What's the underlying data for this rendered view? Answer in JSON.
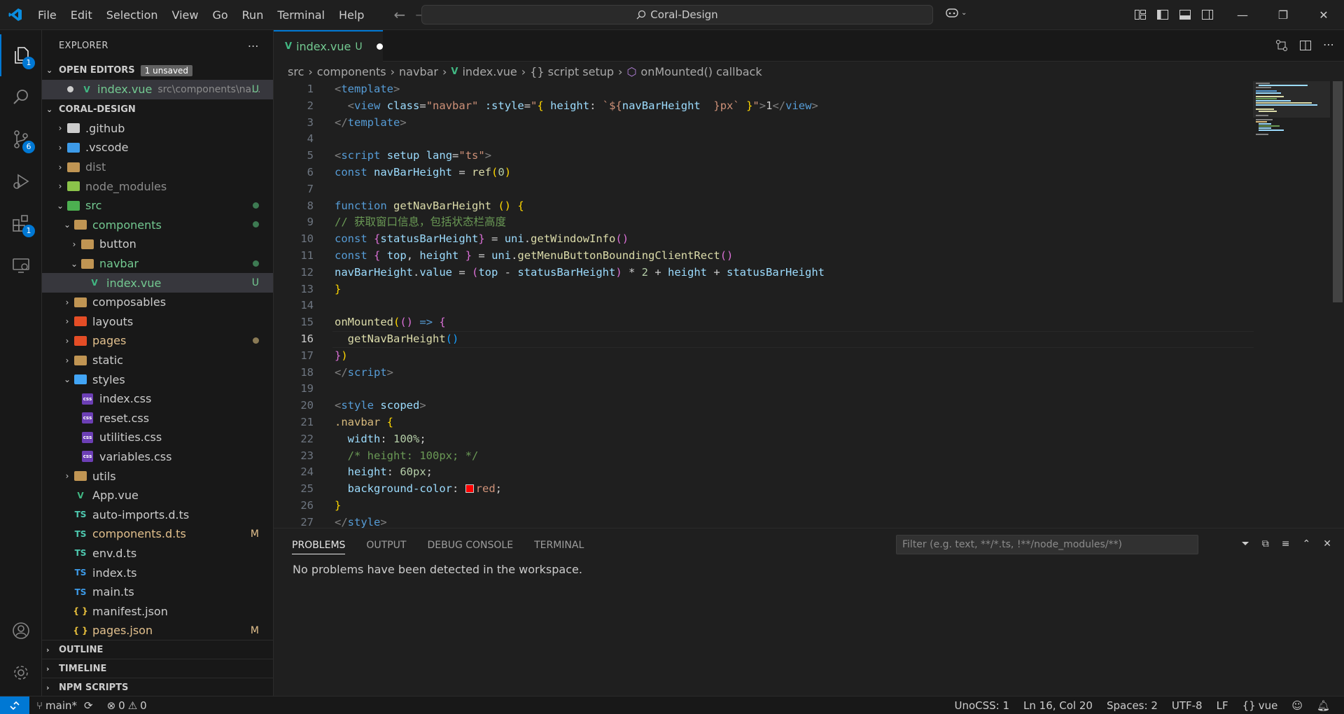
{
  "menu": [
    "File",
    "Edit",
    "Selection",
    "View",
    "Go",
    "Run",
    "Terminal",
    "Help"
  ],
  "search": {
    "label": "Coral-Design"
  },
  "activity": {
    "explorer_badge": "1",
    "scm_badge": "6",
    "extensions_badge": "1"
  },
  "explorer": {
    "title": "EXPLORER",
    "open_editors": {
      "title": "OPEN EDITORS",
      "badge": "1 unsaved",
      "file": "index.vue",
      "path": "src\\components\\na...",
      "status": "U"
    },
    "project": "CORAL-DESIGN",
    "tree": [
      {
        "name": ".github",
        "depth": 0,
        "twisty": "›",
        "icon": "folder-github",
        "color": "#cccccc"
      },
      {
        "name": ".vscode",
        "depth": 0,
        "twisty": "›",
        "icon": "folder-vscode",
        "color": "#cccccc"
      },
      {
        "name": "dist",
        "depth": 0,
        "twisty": "›",
        "icon": "folder-dist",
        "color": "#8c8c8c"
      },
      {
        "name": "node_modules",
        "depth": 0,
        "twisty": "›",
        "icon": "folder-node",
        "color": "#8c8c8c"
      },
      {
        "name": "src",
        "depth": 0,
        "twisty": "⌄",
        "icon": "folder-src",
        "color": "#73c991",
        "status": "dot-green"
      },
      {
        "name": "components",
        "depth": 1,
        "twisty": "⌄",
        "icon": "folder-components",
        "color": "#73c991",
        "status": "dot-green"
      },
      {
        "name": "button",
        "depth": 2,
        "twisty": "›",
        "icon": "folder",
        "color": "#cccccc"
      },
      {
        "name": "navbar",
        "depth": 2,
        "twisty": "⌄",
        "icon": "folder",
        "color": "#73c991",
        "status": "dot-green"
      },
      {
        "name": "index.vue",
        "depth": 3,
        "twisty": "",
        "icon": "vue",
        "color": "#73c991",
        "status": "U",
        "selected": true
      },
      {
        "name": "composables",
        "depth": 1,
        "twisty": "›",
        "icon": "folder",
        "color": "#cccccc"
      },
      {
        "name": "layouts",
        "depth": 1,
        "twisty": "›",
        "icon": "folder-layouts",
        "color": "#cccccc"
      },
      {
        "name": "pages",
        "depth": 1,
        "twisty": "›",
        "icon": "folder-pages",
        "color": "#e2c08d",
        "status": "dot-yellow"
      },
      {
        "name": "static",
        "depth": 1,
        "twisty": "›",
        "icon": "folder",
        "color": "#cccccc"
      },
      {
        "name": "styles",
        "depth": 1,
        "twisty": "⌄",
        "icon": "folder-styles",
        "color": "#cccccc"
      },
      {
        "name": "index.css",
        "depth": 2,
        "twisty": "",
        "icon": "css",
        "color": "#cccccc"
      },
      {
        "name": "reset.css",
        "depth": 2,
        "twisty": "",
        "icon": "css",
        "color": "#cccccc"
      },
      {
        "name": "utilities.css",
        "depth": 2,
        "twisty": "",
        "icon": "css",
        "color": "#cccccc"
      },
      {
        "name": "variables.css",
        "depth": 2,
        "twisty": "",
        "icon": "css",
        "color": "#cccccc"
      },
      {
        "name": "utils",
        "depth": 1,
        "twisty": "›",
        "icon": "folder-utils",
        "color": "#cccccc"
      },
      {
        "name": "App.vue",
        "depth": 1,
        "twisty": "",
        "icon": "vue",
        "color": "#cccccc"
      },
      {
        "name": "auto-imports.d.ts",
        "depth": 1,
        "twisty": "",
        "icon": "ts-green",
        "color": "#cccccc"
      },
      {
        "name": "components.d.ts",
        "depth": 1,
        "twisty": "",
        "icon": "ts-green",
        "color": "#e2c08d",
        "status": "M"
      },
      {
        "name": "env.d.ts",
        "depth": 1,
        "twisty": "",
        "icon": "ts-green",
        "color": "#cccccc"
      },
      {
        "name": "index.ts",
        "depth": 1,
        "twisty": "",
        "icon": "ts",
        "color": "#cccccc"
      },
      {
        "name": "main.ts",
        "depth": 1,
        "twisty": "",
        "icon": "ts",
        "color": "#cccccc"
      },
      {
        "name": "manifest.json",
        "depth": 1,
        "twisty": "",
        "icon": "json",
        "color": "#cccccc"
      },
      {
        "name": "pages.json",
        "depth": 1,
        "twisty": "",
        "icon": "json",
        "color": "#e2c08d",
        "status": "M"
      }
    ],
    "sections": [
      "OUTLINE",
      "TIMELINE",
      "NPM SCRIPTS"
    ]
  },
  "editor": {
    "tab": {
      "label": "index.vue",
      "status": "U"
    },
    "breadcrumb": [
      "src",
      "components",
      "navbar",
      "index.vue",
      "{} script setup",
      "onMounted() callback"
    ],
    "lines": [
      [
        [
          "tag",
          "<"
        ],
        [
          "tn",
          "template"
        ],
        [
          "tag",
          ">"
        ]
      ],
      [
        [
          "pl",
          "  "
        ],
        [
          "tag",
          "<"
        ],
        [
          "tn",
          "view"
        ],
        [
          "pl",
          " "
        ],
        [
          "at",
          "class"
        ],
        [
          "pl",
          "="
        ],
        [
          "s",
          "\"navbar\""
        ],
        [
          "pl",
          " "
        ],
        [
          "at",
          ":style"
        ],
        [
          "pl",
          "="
        ],
        [
          "s",
          "\""
        ],
        [
          "y",
          "{"
        ],
        [
          "pl",
          " "
        ],
        [
          "v",
          "height"
        ],
        [
          "pl",
          ": "
        ],
        [
          "s",
          "`${"
        ],
        [
          "v",
          "navBarHeight"
        ],
        [
          "s",
          "  }px`"
        ],
        [
          "pl",
          " "
        ],
        [
          "y",
          "}"
        ],
        [
          "s",
          "\""
        ],
        [
          "tag",
          ">"
        ],
        [
          "pl",
          "1"
        ],
        [
          "tag",
          "</"
        ],
        [
          "tn",
          "view"
        ],
        [
          "tag",
          ">"
        ]
      ],
      [
        [
          "tag",
          "</"
        ],
        [
          "tn",
          "template"
        ],
        [
          "tag",
          ">"
        ]
      ],
      [
        [
          "pl",
          ""
        ]
      ],
      [
        [
          "tag",
          "<"
        ],
        [
          "tn",
          "script"
        ],
        [
          "pl",
          " "
        ],
        [
          "at",
          "setup"
        ],
        [
          "pl",
          " "
        ],
        [
          "at",
          "lang"
        ],
        [
          "pl",
          "="
        ],
        [
          "s",
          "\"ts\""
        ],
        [
          "tag",
          ">"
        ]
      ],
      [
        [
          "k",
          "const"
        ],
        [
          "pl",
          " "
        ],
        [
          "v",
          "navBarHeight"
        ],
        [
          "pl",
          " = "
        ],
        [
          "f",
          "ref"
        ],
        [
          "y",
          "("
        ],
        [
          "n",
          "0"
        ],
        [
          "y",
          ")"
        ]
      ],
      [
        [
          "pl",
          ""
        ]
      ],
      [
        [
          "k",
          "function"
        ],
        [
          "pl",
          " "
        ],
        [
          "f",
          "getNavBarHeight"
        ],
        [
          "pl",
          " "
        ],
        [
          "y",
          "()"
        ],
        [
          "pl",
          " "
        ],
        [
          "y",
          "{"
        ]
      ],
      [
        [
          "c",
          "// 获取窗口信息，包括状态栏高度"
        ]
      ],
      [
        [
          "k",
          "const"
        ],
        [
          "pl",
          " "
        ],
        [
          "p",
          "{"
        ],
        [
          "v",
          "statusBarHeight"
        ],
        [
          "p",
          "}"
        ],
        [
          "pl",
          " = "
        ],
        [
          "v",
          "uni"
        ],
        [
          "pl",
          "."
        ],
        [
          "f",
          "getWindowInfo"
        ],
        [
          "p",
          "()"
        ]
      ],
      [
        [
          "k",
          "const"
        ],
        [
          "pl",
          " "
        ],
        [
          "p",
          "{"
        ],
        [
          "pl",
          " "
        ],
        [
          "v",
          "top"
        ],
        [
          "pl",
          ", "
        ],
        [
          "v",
          "height"
        ],
        [
          "pl",
          " "
        ],
        [
          "p",
          "}"
        ],
        [
          "pl",
          " = "
        ],
        [
          "v",
          "uni"
        ],
        [
          "pl",
          "."
        ],
        [
          "f",
          "getMenuButtonBoundingClientRect"
        ],
        [
          "p",
          "()"
        ]
      ],
      [
        [
          "v",
          "navBarHeight"
        ],
        [
          "pl",
          "."
        ],
        [
          "v",
          "value"
        ],
        [
          "pl",
          " = "
        ],
        [
          "p",
          "("
        ],
        [
          "v",
          "top"
        ],
        [
          "pl",
          " - "
        ],
        [
          "v",
          "statusBarHeight"
        ],
        [
          "p",
          ")"
        ],
        [
          "pl",
          " * "
        ],
        [
          "n",
          "2"
        ],
        [
          "pl",
          " + "
        ],
        [
          "v",
          "height"
        ],
        [
          "pl",
          " + "
        ],
        [
          "v",
          "statusBarHeight"
        ]
      ],
      [
        [
          "y",
          "}"
        ]
      ],
      [
        [
          "pl",
          ""
        ]
      ],
      [
        [
          "f",
          "onMounted"
        ],
        [
          "y",
          "("
        ],
        [
          "p",
          "()"
        ],
        [
          "pl",
          " "
        ],
        [
          "k",
          "=>"
        ],
        [
          "pl",
          " "
        ],
        [
          "p",
          "{"
        ]
      ],
      [
        [
          "pl",
          "  "
        ],
        [
          "f",
          "getNavBarHeight"
        ],
        [
          "b2",
          "()"
        ]
      ],
      [
        [
          "p",
          "}"
        ],
        [
          "y",
          ")"
        ]
      ],
      [
        [
          "tag",
          "</"
        ],
        [
          "tn",
          "script"
        ],
        [
          "tag",
          ">"
        ]
      ],
      [
        [
          "pl",
          ""
        ]
      ],
      [
        [
          "tag",
          "<"
        ],
        [
          "tn",
          "style"
        ],
        [
          "pl",
          " "
        ],
        [
          "at",
          "scoped"
        ],
        [
          "tag",
          ">"
        ]
      ],
      [
        [
          "sel2",
          ".navbar"
        ],
        [
          "pl",
          " "
        ],
        [
          "y",
          "{"
        ]
      ],
      [
        [
          "pl",
          "  "
        ],
        [
          "at",
          "width"
        ],
        [
          "pl",
          ": "
        ],
        [
          "n",
          "100%"
        ],
        [
          "pl",
          ";"
        ]
      ],
      [
        [
          "pl",
          "  "
        ],
        [
          "c",
          "/* height: 100px; */"
        ]
      ],
      [
        [
          "pl",
          "  "
        ],
        [
          "at",
          "height"
        ],
        [
          "pl",
          ": "
        ],
        [
          "n",
          "60px"
        ],
        [
          "pl",
          ";"
        ]
      ],
      [
        [
          "pl",
          "  "
        ],
        [
          "at",
          "background-color"
        ],
        [
          "pl",
          ": "
        ],
        [
          "swatch",
          ""
        ],
        [
          "s",
          "red"
        ],
        [
          "pl",
          ";"
        ]
      ],
      [
        [
          "y",
          "}"
        ]
      ],
      [
        [
          "tag",
          "</"
        ],
        [
          "tn",
          "style"
        ],
        [
          "tag",
          ">"
        ]
      ]
    ],
    "current_line": 16
  },
  "panel": {
    "tabs": [
      "PROBLEMS",
      "OUTPUT",
      "DEBUG CONSOLE",
      "TERMINAL"
    ],
    "filter_placeholder": "Filter (e.g. text, **/*.ts, !**/node_modules/**)",
    "message": "No problems have been detected in the workspace."
  },
  "status": {
    "branch": "main*",
    "errors": "0",
    "warnings": "0",
    "unocss": "UnoCSS: 1",
    "position": "Ln 16, Col 20",
    "spaces": "Spaces: 2",
    "encoding": "UTF-8",
    "eol": "LF",
    "language": "vue"
  },
  "colors": {
    "accent": "#0078d4",
    "vue": "#41b883",
    "ts": "#3178c6",
    "css": "#6c3fb5",
    "modified": "#e2c08d",
    "untracked": "#73c991"
  }
}
